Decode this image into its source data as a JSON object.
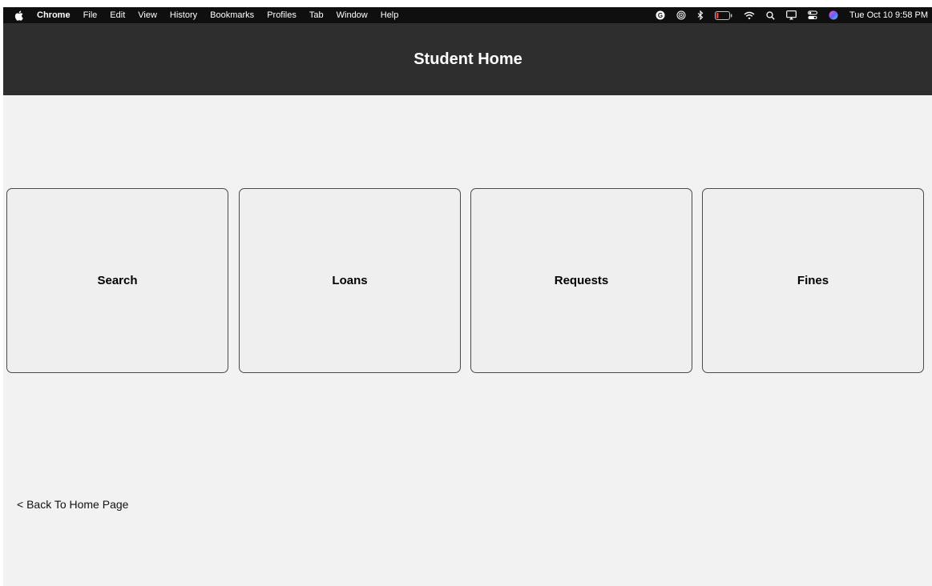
{
  "menubar": {
    "app_name": "Chrome",
    "items": [
      "File",
      "Edit",
      "View",
      "History",
      "Bookmarks",
      "Profiles",
      "Tab",
      "Window",
      "Help"
    ],
    "clock": "Tue Oct 10  9:58 PM",
    "status_icons": [
      "grammarly-icon",
      "airdrop-icon",
      "bluetooth-icon",
      "battery-icon",
      "wifi-icon",
      "spotlight-search-icon",
      "screen-mirroring-icon",
      "control-center-icon",
      "siri-icon"
    ]
  },
  "header": {
    "title": "Student Home"
  },
  "cards": [
    {
      "label": "Search"
    },
    {
      "label": "Loans"
    },
    {
      "label": "Requests"
    },
    {
      "label": "Fines"
    }
  ],
  "back_link": {
    "label": "< Back To Home Page"
  },
  "colors": {
    "header_bg": "#2e2e2e",
    "page_bg": "#f2f2f2",
    "card_bg": "#efefef",
    "card_border": "#4a4a4a"
  }
}
